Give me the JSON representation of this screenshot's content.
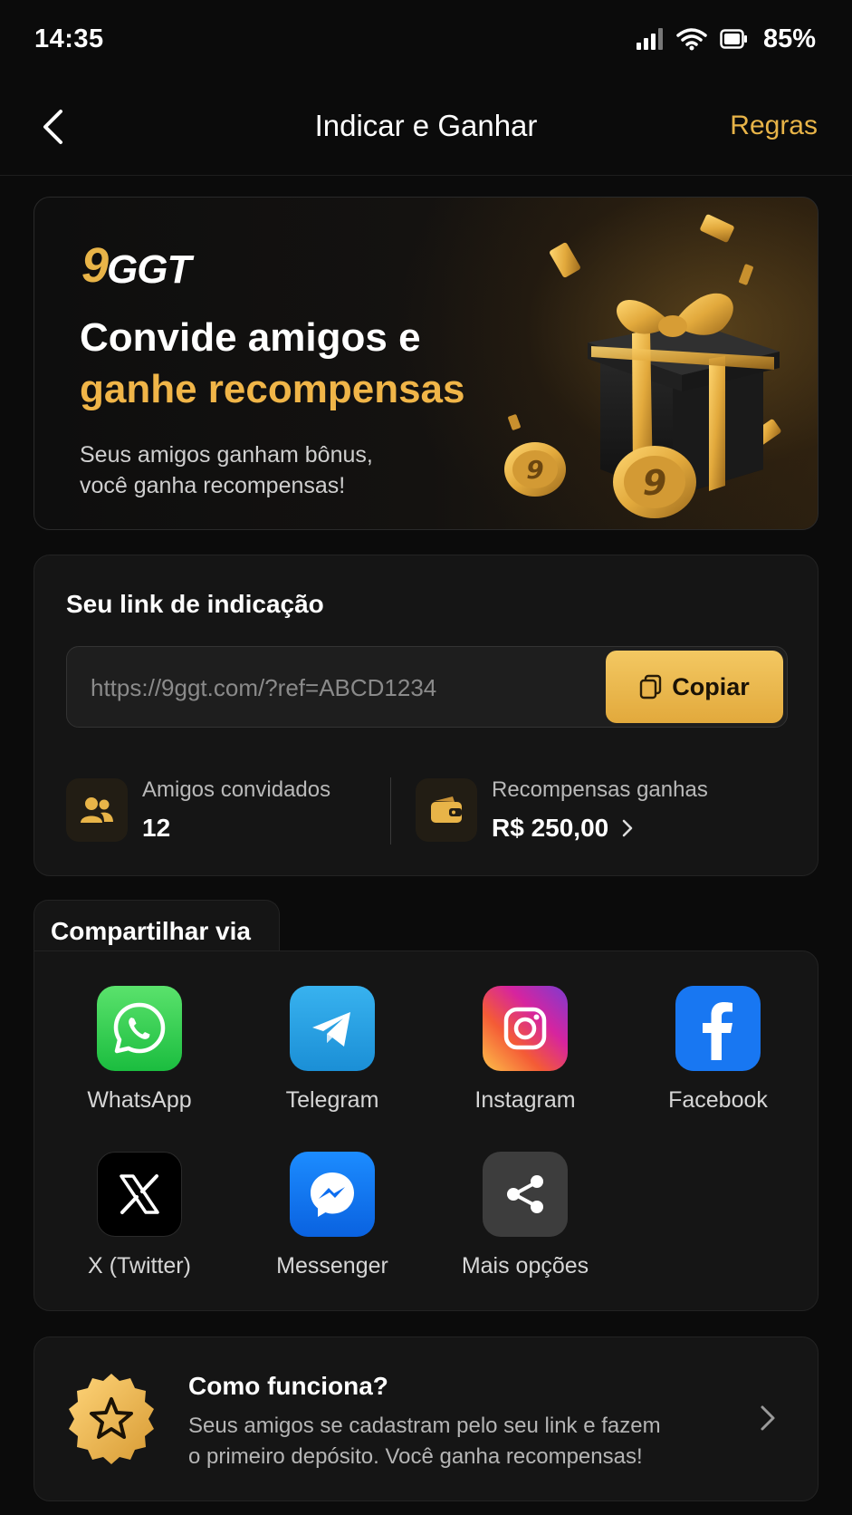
{
  "status_bar": {
    "time": "14:35",
    "battery": "85%"
  },
  "header": {
    "title": "Indicar e Ganhar",
    "rules": "Regras"
  },
  "hero": {
    "brand_nine": "9",
    "brand_ggt": "GGT",
    "title_line1": "Convide amigos e",
    "title_line2": "ganhe recompensas",
    "subtitle_line1": "Seus amigos ganham bônus,",
    "subtitle_line2": "você ganha recompensas!"
  },
  "referral": {
    "title": "Seu link de indicação",
    "link": "https://9ggt.com/?ref=ABCD1234",
    "copy_label": "Copiar",
    "friends_label": "Amigos convidados",
    "friends_value": "12",
    "rewards_label": "Recompensas ganhas",
    "rewards_value": "R$ 250,00"
  },
  "share": {
    "title": "Compartilhar via",
    "items": [
      {
        "label": "WhatsApp",
        "icon": "whatsapp-icon",
        "color": "#25d366"
      },
      {
        "label": "Telegram",
        "icon": "telegram-icon",
        "color": "#2aa3e0"
      },
      {
        "label": "Instagram",
        "icon": "instagram-icon",
        "color": "#d6249f"
      },
      {
        "label": "Facebook",
        "icon": "facebook-icon",
        "color": "#1877f2"
      },
      {
        "label": "X (Twitter)",
        "icon": "x-icon",
        "color": "#000000"
      },
      {
        "label": "Messenger",
        "icon": "messenger-icon",
        "color": "#0b72ff"
      },
      {
        "label": "Mais opções",
        "icon": "share-icon",
        "color": "#3d3d3d"
      }
    ]
  },
  "how": {
    "title": "Como funciona?",
    "desc_line1": "Seus amigos se cadastram pelo seu link e fazem",
    "desc_line2": "o primeiro depósito. Você ganha recompensas!"
  },
  "colors": {
    "accent": "#e8b448",
    "background": "#0b0b0b",
    "card": "#151515"
  }
}
